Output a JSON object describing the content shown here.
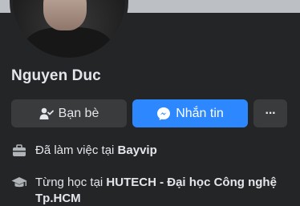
{
  "profile": {
    "name": "Nguyen Duc"
  },
  "actions": {
    "friends_label": "Bạn bè",
    "message_label": "Nhắn tin",
    "more_label": "···"
  },
  "intro": {
    "work_prefix": "Đã làm việc tại ",
    "work_place": "Bayvip",
    "study_prefix": "Từng học tại ",
    "study_place": "HUTECH - Đại học Công nghệ Tp.HCM"
  },
  "colors": {
    "background": "#242526",
    "button_secondary": "#3a3b3c",
    "button_primary": "#2d88ff",
    "text_primary": "#e4e6eb"
  },
  "icons": {
    "friends": "person-check-icon",
    "message": "messenger-icon",
    "more": "more-dots-icon",
    "work": "briefcase-icon",
    "study": "graduation-cap-icon"
  }
}
